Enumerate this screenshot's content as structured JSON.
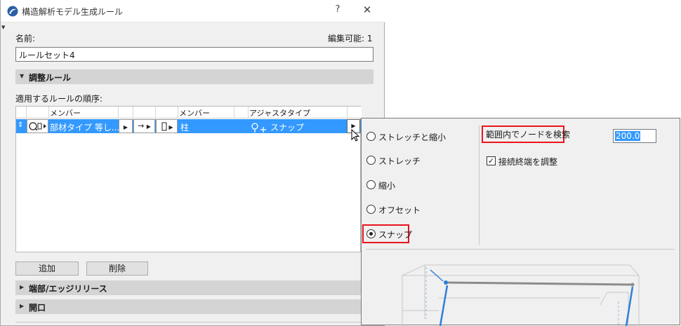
{
  "window": {
    "title": "構造解析モデル生成ルール",
    "help": "?",
    "close": "✕"
  },
  "form": {
    "name_label": "名前:",
    "editable_label": "編集可能: 1",
    "name_value": "ルールセット4"
  },
  "sections": {
    "adjust_rules": "調整ルール",
    "edge_release": "端部/エッジリリース",
    "openings": "開口"
  },
  "rules": {
    "order_label": "適用するルールの順序:",
    "columns": [
      "メンバー",
      "メンバー",
      "アジャスタタイプ"
    ],
    "row": {
      "member1": "部材タイプ 等し...",
      "member2": "柱",
      "adjust_type": "スナップ"
    }
  },
  "buttons": {
    "add": "追加",
    "delete": "削除"
  },
  "popup": {
    "options": [
      "ストレッチと縮小",
      "ストレッチ",
      "縮小",
      "オフセット",
      "スナップ"
    ],
    "selected": "スナップ",
    "search_label": "範囲内でノードを検索",
    "search_value": "200.0",
    "adjust_ends_label": "接続終端を調整",
    "adjust_ends_checked": true
  },
  "colors": {
    "selection": "#3399ff",
    "highlight_box": "#e8141e",
    "diagram_blue": "#2f7fd9"
  }
}
